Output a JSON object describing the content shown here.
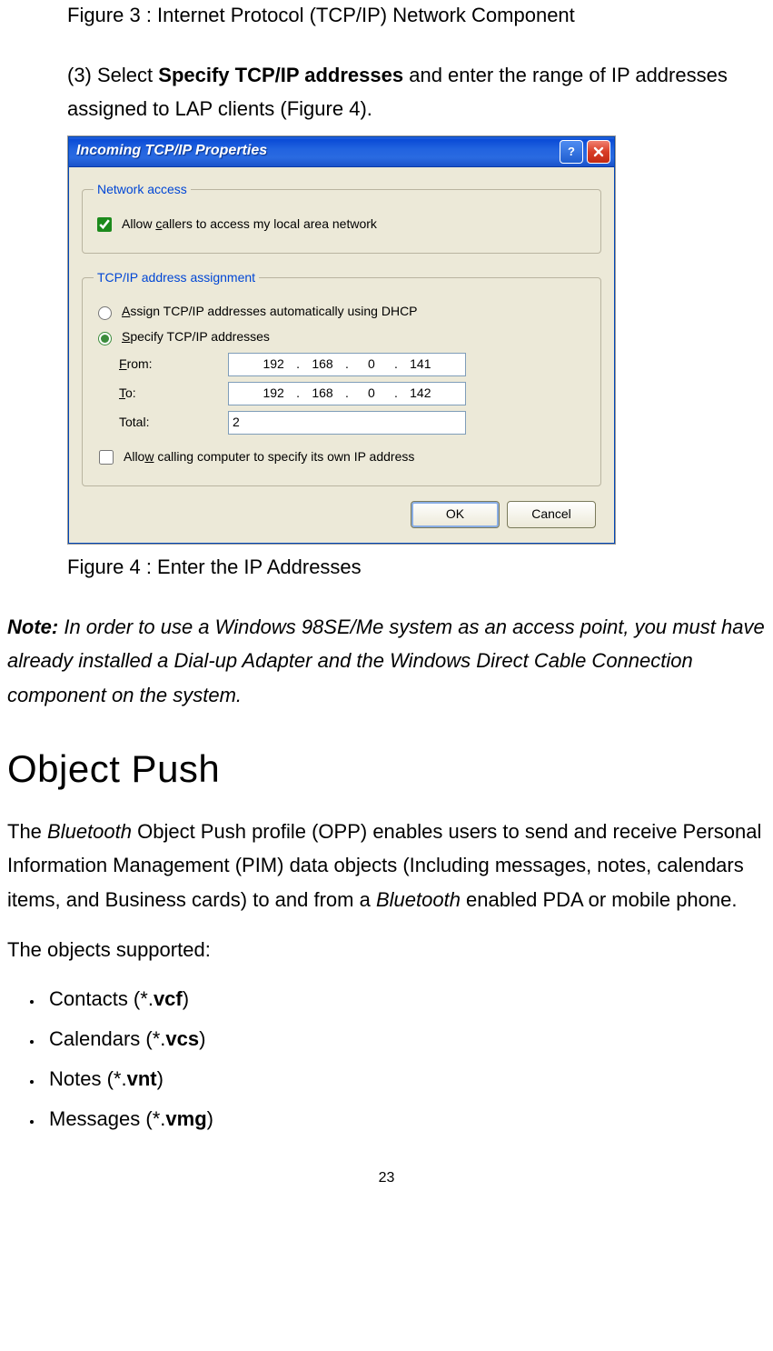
{
  "figure3_caption": "Figure 3 : Internet Protocol (TCP/IP) Network Component",
  "step3": {
    "prefix": "(3) Select ",
    "bold": "Specify TCP/IP addresses",
    "suffix": " and enter the range of IP addresses assigned to LAP clients (Figure 4)."
  },
  "dialog": {
    "title": "Incoming TCP/IP Properties",
    "group1": {
      "legend": "Network access",
      "allow_callers_checked": true,
      "allow_callers_pre": "Allow ",
      "allow_callers_u": "c",
      "allow_callers_post": "allers to access my local area network"
    },
    "group2": {
      "legend": "TCP/IP address assignment",
      "radio_selected": "specify",
      "dhcp_u": "A",
      "dhcp_post": "ssign TCP/IP addresses automatically using DHCP",
      "specify_u": "S",
      "specify_post": "pecify TCP/IP addresses",
      "from_u": "F",
      "from_post": "rom:",
      "to_u": "T",
      "to_post": "o:",
      "total_label": "Total:",
      "from_ip": [
        "192",
        "168",
        "0",
        "141"
      ],
      "to_ip": [
        "192",
        "168",
        "0",
        "142"
      ],
      "total_value": "2",
      "allow_own_checked": false,
      "allow_own_pre": "Allo",
      "allow_own_u": "w",
      "allow_own_post": " calling computer to specify its own IP address"
    },
    "buttons": {
      "ok": "OK",
      "cancel": "Cancel"
    }
  },
  "figure4_caption": "Figure 4 : Enter the IP Addresses",
  "note": {
    "label": "Note:",
    "text": " In order to use a Windows 98SE/Me system as an access point, you must have already installed a Dial-up Adapter and the Windows Direct Cable Connection component on the system."
  },
  "section_heading": "Object Push",
  "opp_para": {
    "p1a": "The ",
    "p1b": "Bluetooth",
    "p1c": " Object Push profile (OPP) enables users to send and receive Personal Information Management (PIM) data objects (Including messages, notes, calendars items, and Business cards) to and from a ",
    "p1d": "Bluetooth",
    "p1e": " enabled PDA or mobile phone."
  },
  "objects_supported_label": "The objects supported:",
  "objects": [
    {
      "pre": "Contacts (*.",
      "ext": "vcf",
      "post": ")"
    },
    {
      "pre": "Calendars (*.",
      "ext": "vcs",
      "post": ")"
    },
    {
      "pre": "Notes (*.",
      "ext": "vnt",
      "post": ")"
    },
    {
      "pre": "Messages (*.",
      "ext": "vmg",
      "post": ")"
    }
  ],
  "page_number": "23"
}
